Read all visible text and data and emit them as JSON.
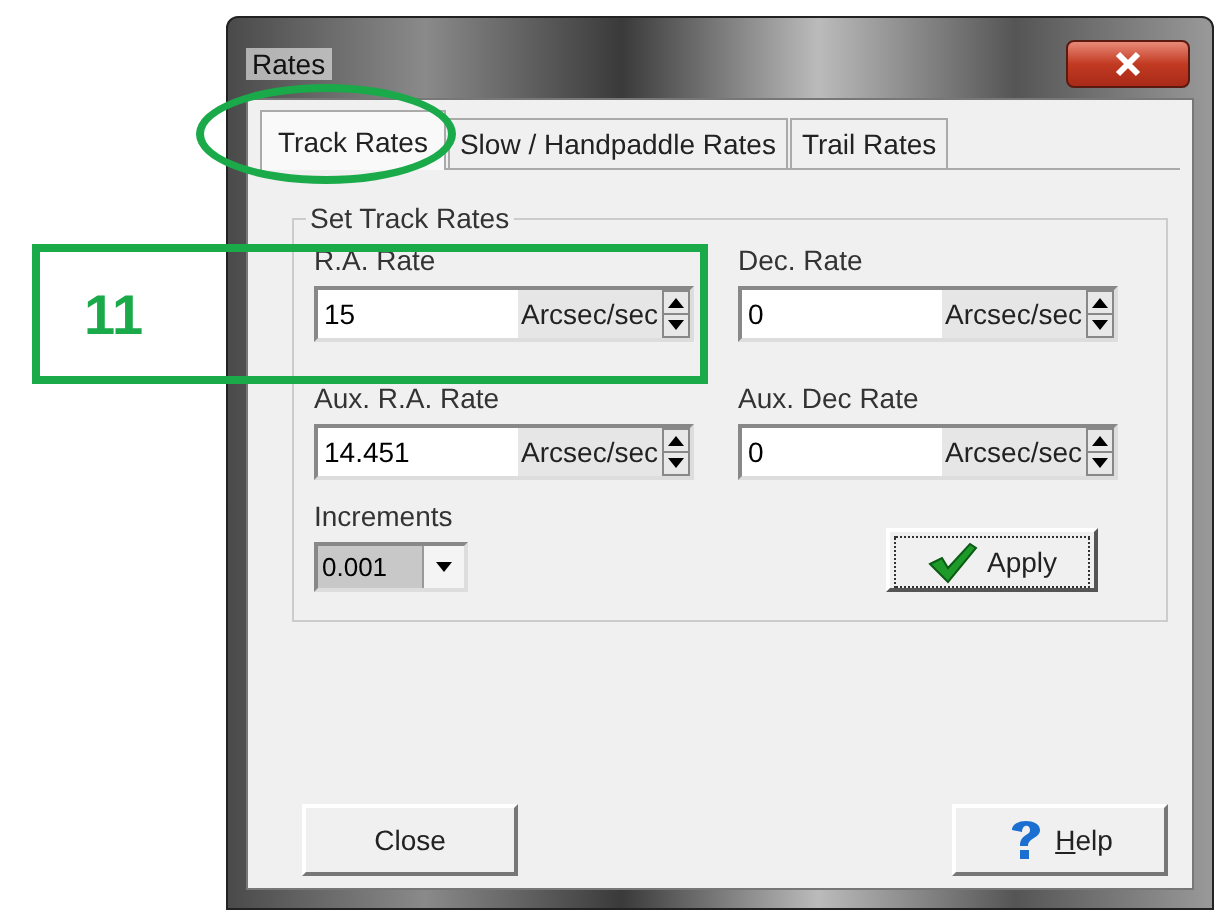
{
  "window": {
    "title": "Rates"
  },
  "tabs": [
    {
      "label": "Track Rates",
      "selected": true
    },
    {
      "label": "Slow / Handpaddle Rates",
      "selected": false
    },
    {
      "label": "Trail Rates",
      "selected": false
    }
  ],
  "group": {
    "title": "Set Track Rates",
    "fields": [
      {
        "label": "R.A. Rate",
        "value": "15",
        "unit": "Arcsec/sec"
      },
      {
        "label": "Dec. Rate",
        "value": "0",
        "unit": "Arcsec/sec"
      },
      {
        "label": "Aux. R.A. Rate",
        "value": "14.451",
        "unit": "Arcsec/sec"
      },
      {
        "label": "Aux. Dec Rate",
        "value": "0",
        "unit": "Arcsec/sec"
      }
    ],
    "increments": {
      "label": "Increments",
      "value": "0.001"
    },
    "apply_button": "Apply"
  },
  "buttons": {
    "close": "Close",
    "help": "Help"
  },
  "annotations": [
    {
      "kind": "ellipse"
    },
    {
      "kind": "box",
      "label": "11"
    }
  ]
}
